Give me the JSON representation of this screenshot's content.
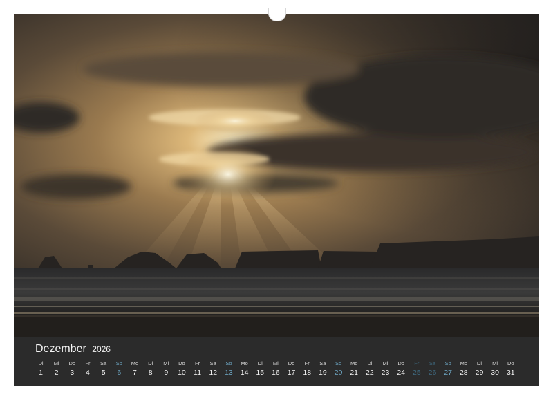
{
  "calendar": {
    "month": "Dezember",
    "year": "2026",
    "colors": {
      "strip": "#2b2b2b",
      "text": "#f4f4f4",
      "sunday": "#6ea7c4",
      "holiday": "#3f6b82"
    },
    "days": [
      {
        "name": "Di",
        "num": "1",
        "type": "weekday"
      },
      {
        "name": "Mi",
        "num": "2",
        "type": "weekday"
      },
      {
        "name": "Do",
        "num": "3",
        "type": "weekday"
      },
      {
        "name": "Fr",
        "num": "4",
        "type": "weekday"
      },
      {
        "name": "Sa",
        "num": "5",
        "type": "weekday"
      },
      {
        "name": "So",
        "num": "6",
        "type": "sunday"
      },
      {
        "name": "Mo",
        "num": "7",
        "type": "weekday"
      },
      {
        "name": "Di",
        "num": "8",
        "type": "weekday"
      },
      {
        "name": "Mi",
        "num": "9",
        "type": "weekday"
      },
      {
        "name": "Do",
        "num": "10",
        "type": "weekday"
      },
      {
        "name": "Fr",
        "num": "11",
        "type": "weekday"
      },
      {
        "name": "Sa",
        "num": "12",
        "type": "weekday"
      },
      {
        "name": "So",
        "num": "13",
        "type": "sunday"
      },
      {
        "name": "Mo",
        "num": "14",
        "type": "weekday"
      },
      {
        "name": "Di",
        "num": "15",
        "type": "weekday"
      },
      {
        "name": "Mi",
        "num": "16",
        "type": "weekday"
      },
      {
        "name": "Do",
        "num": "17",
        "type": "weekday"
      },
      {
        "name": "Fr",
        "num": "18",
        "type": "weekday"
      },
      {
        "name": "Sa",
        "num": "19",
        "type": "weekday"
      },
      {
        "name": "So",
        "num": "20",
        "type": "sunday"
      },
      {
        "name": "Mo",
        "num": "21",
        "type": "weekday"
      },
      {
        "name": "Di",
        "num": "22",
        "type": "weekday"
      },
      {
        "name": "Mi",
        "num": "23",
        "type": "weekday"
      },
      {
        "name": "Do",
        "num": "24",
        "type": "weekday"
      },
      {
        "name": "Fr",
        "num": "25",
        "type": "holiday"
      },
      {
        "name": "Sa",
        "num": "26",
        "type": "holiday"
      },
      {
        "name": "So",
        "num": "27",
        "type": "sunday"
      },
      {
        "name": "Mo",
        "num": "28",
        "type": "weekday"
      },
      {
        "name": "Di",
        "num": "29",
        "type": "weekday"
      },
      {
        "name": "Mi",
        "num": "30",
        "type": "weekday"
      },
      {
        "name": "Do",
        "num": "31",
        "type": "weekday"
      }
    ]
  }
}
